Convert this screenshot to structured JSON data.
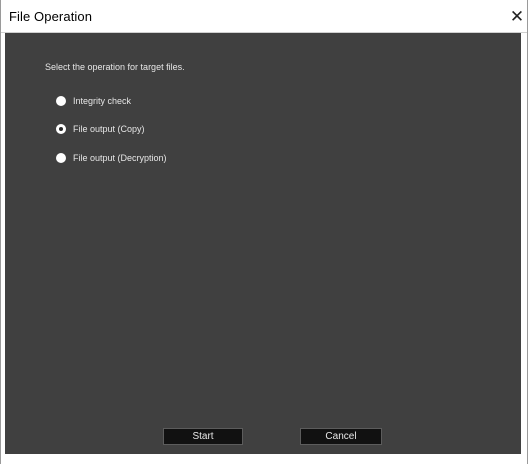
{
  "window": {
    "title": "File Operation",
    "close_glyph": "✕"
  },
  "dialog": {
    "prompt": "Select the operation for target files.",
    "options": [
      {
        "label": "Integrity check",
        "checked": false
      },
      {
        "label": "File output (Copy)",
        "checked": true
      },
      {
        "label": "File output (Decryption)",
        "checked": false
      }
    ],
    "start_label": "Start",
    "cancel_label": "Cancel"
  },
  "colors": {
    "client_background": "#404040",
    "text": "#e6e6e6",
    "button_background": "#111111"
  }
}
